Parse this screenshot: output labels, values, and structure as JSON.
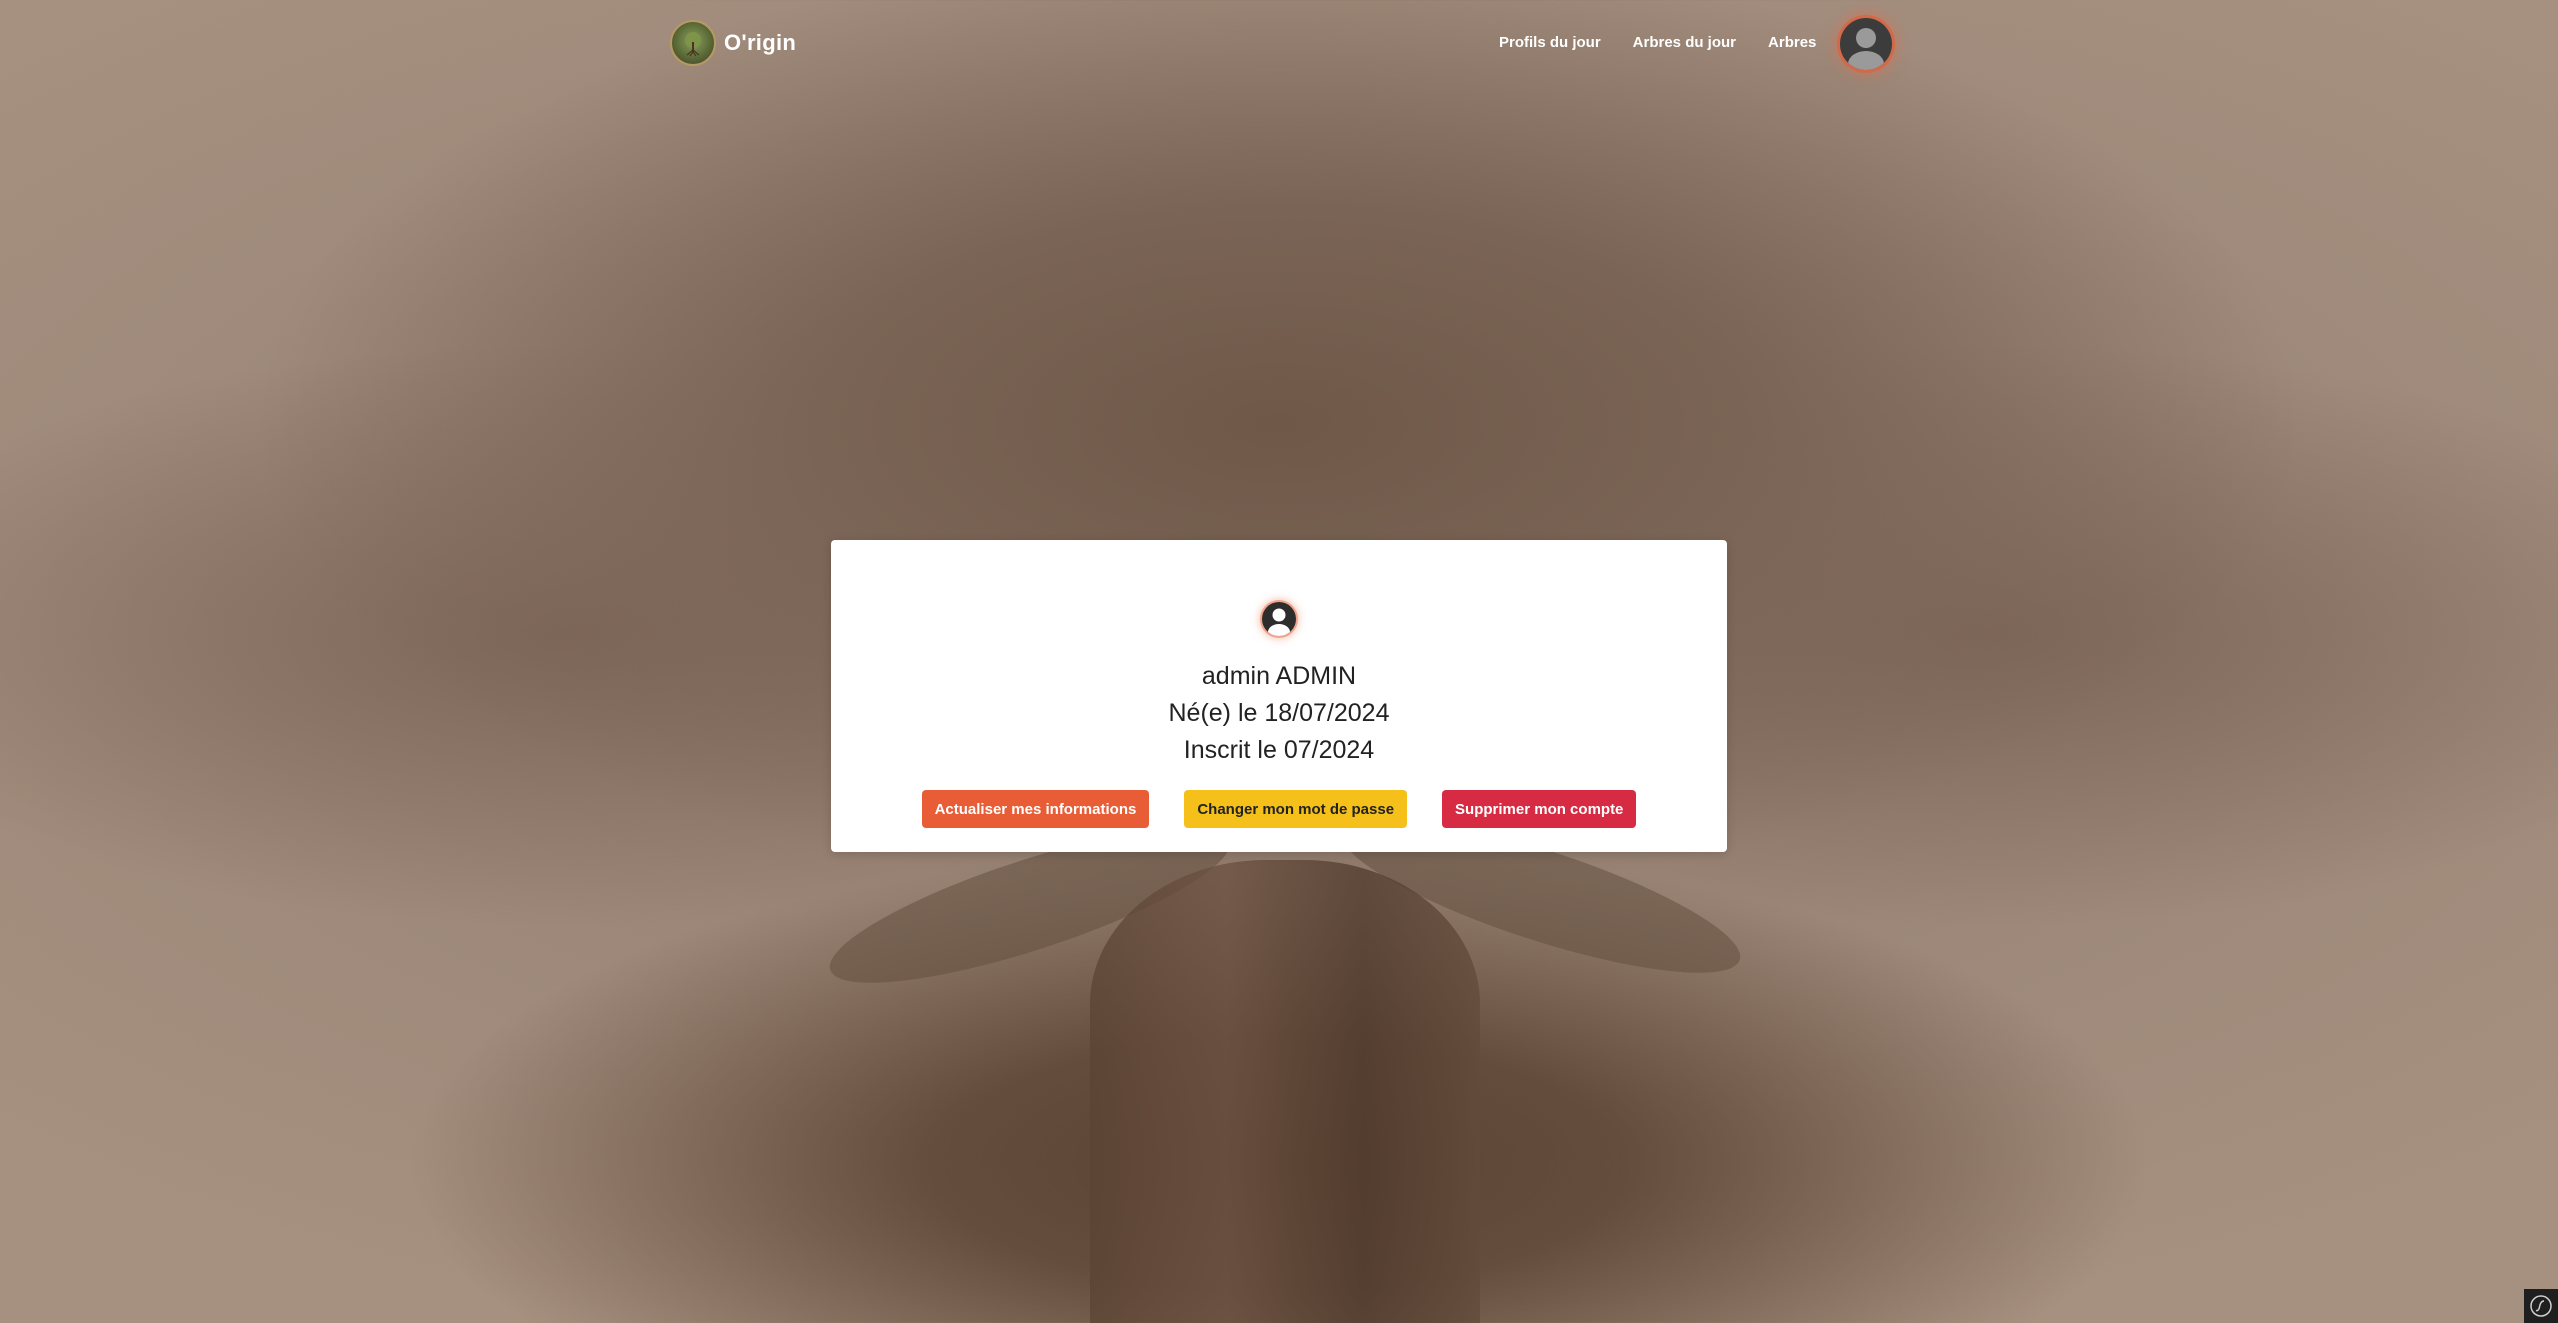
{
  "brand": {
    "name": "O'rigin",
    "logo_icon": "tree-logo-icon"
  },
  "nav": {
    "items": [
      {
        "label": "Profils du jour"
      },
      {
        "label": "Arbres du jour"
      },
      {
        "label": "Arbres"
      }
    ],
    "user_icon": "user-avatar-icon"
  },
  "profile": {
    "name": "admin ADMIN",
    "birth": "Né(e) le 18/07/2024",
    "registered": "Inscrit le 07/2024"
  },
  "actions": {
    "update_label": "Actualiser mes informations",
    "password_label": "Changer mon mot de passe",
    "delete_label": "Supprimer mon compte"
  },
  "colors": {
    "update": "#e85d35",
    "password": "#f5c01a",
    "delete": "#d62b43",
    "avatar_ring": "#d06a48"
  },
  "debug_icon": "symfony-toolbar-icon"
}
